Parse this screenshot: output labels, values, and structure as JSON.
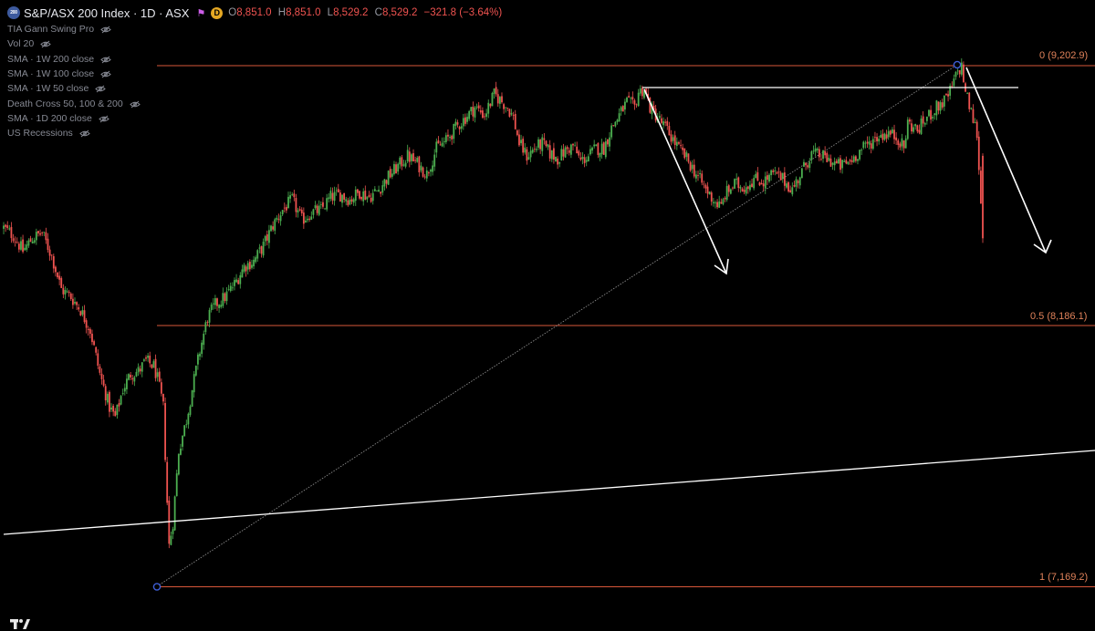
{
  "header": {
    "title": "S&P/ASX 200 Index · 1D · ASX",
    "logo_text": "200",
    "badge": "D",
    "ohlc": [
      {
        "key": "O",
        "value": "8,851.0"
      },
      {
        "key": "H",
        "value": "8,851.0"
      },
      {
        "key": "L",
        "value": "8,529.2"
      },
      {
        "key": "C",
        "value": "8,529.2"
      }
    ],
    "change": "−321.8 (−3.64%)"
  },
  "indicators": [
    {
      "label": "TIA Gann Swing Pro"
    },
    {
      "label": "Vol 20"
    },
    {
      "label": "SMA · 1W 200 close"
    },
    {
      "label": "SMA · 1W 100 close"
    },
    {
      "label": "SMA · 1W 50 close"
    },
    {
      "label": "Death Cross 50, 100 & 200"
    },
    {
      "label": "SMA · 1D 200 close"
    },
    {
      "label": "US Recessions"
    }
  ],
  "colors": {
    "background": "#000000",
    "up": "#4caf50",
    "down": "#ef5350",
    "fib_line": "#d9573a",
    "fib_text": "#e0825a",
    "drawing": "#ffffff",
    "pivot": "#3f5fd8"
  },
  "chart_data": {
    "type": "candlestick",
    "title": "S&P/ASX 200 Index · 1D · ASX",
    "ylim": [
      7080,
      9290
    ],
    "fib_levels": [
      {
        "label": "0 (9,202.9)",
        "ratio": 0,
        "value": 9202.9
      },
      {
        "label": "0.5 (8,186.1)",
        "ratio": 0.5,
        "value": 8186.1
      },
      {
        "label": "1 (7,169.2)",
        "ratio": 1,
        "value": 7169.2
      }
    ],
    "close_path": [
      [
        0,
        8570
      ],
      [
        5,
        8540
      ],
      [
        10,
        8480
      ],
      [
        15,
        8530
      ],
      [
        20,
        8550
      ],
      [
        25,
        8460
      ],
      [
        30,
        8330
      ],
      [
        35,
        8300
      ],
      [
        40,
        8250
      ],
      [
        45,
        8170
      ],
      [
        50,
        8000
      ],
      [
        55,
        7870
      ],
      [
        58,
        7830
      ],
      [
        62,
        7940
      ],
      [
        66,
        8000
      ],
      [
        70,
        8010
      ],
      [
        74,
        8050
      ],
      [
        78,
        8030
      ],
      [
        80,
        7980
      ],
      [
        83,
        7870
      ],
      [
        85,
        7500
      ],
      [
        86,
        7330
      ],
      [
        88,
        7420
      ],
      [
        91,
        7700
      ],
      [
        95,
        7820
      ],
      [
        98,
        7940
      ],
      [
        102,
        8090
      ],
      [
        106,
        8220
      ],
      [
        110,
        8270
      ],
      [
        115,
        8300
      ],
      [
        120,
        8350
      ],
      [
        125,
        8420
      ],
      [
        130,
        8440
      ],
      [
        135,
        8500
      ],
      [
        140,
        8580
      ],
      [
        145,
        8640
      ],
      [
        150,
        8680
      ],
      [
        155,
        8600
      ],
      [
        160,
        8630
      ],
      [
        165,
        8640
      ],
      [
        170,
        8690
      ],
      [
        175,
        8700
      ],
      [
        180,
        8680
      ],
      [
        185,
        8710
      ],
      [
        190,
        8690
      ],
      [
        195,
        8720
      ],
      [
        200,
        8770
      ],
      [
        205,
        8810
      ],
      [
        210,
        8850
      ],
      [
        215,
        8820
      ],
      [
        220,
        8780
      ],
      [
        225,
        8880
      ],
      [
        230,
        8910
      ],
      [
        235,
        8960
      ],
      [
        240,
        9000
      ],
      [
        245,
        9040
      ],
      [
        250,
        9010
      ],
      [
        255,
        9090
      ],
      [
        258,
        9070
      ],
      [
        262,
        9040
      ],
      [
        265,
        9000
      ],
      [
        268,
        8900
      ],
      [
        272,
        8850
      ],
      [
        276,
        8880
      ],
      [
        280,
        8900
      ],
      [
        284,
        8860
      ],
      [
        288,
        8840
      ],
      [
        292,
        8870
      ],
      [
        296,
        8890
      ],
      [
        300,
        8830
      ],
      [
        304,
        8850
      ],
      [
        308,
        8880
      ],
      [
        312,
        8880
      ],
      [
        316,
        8960
      ],
      [
        320,
        9010
      ],
      [
        324,
        9060
      ],
      [
        328,
        9040
      ],
      [
        330,
        9100
      ],
      [
        333,
        9110
      ],
      [
        336,
        9040
      ],
      [
        340,
        9000
      ],
      [
        345,
        8950
      ],
      [
        350,
        8890
      ],
      [
        355,
        8840
      ],
      [
        360,
        8780
      ],
      [
        365,
        8720
      ],
      [
        370,
        8670
      ],
      [
        373,
        8650
      ],
      [
        375,
        8700
      ],
      [
        380,
        8740
      ],
      [
        385,
        8730
      ],
      [
        390,
        8760
      ],
      [
        395,
        8750
      ],
      [
        400,
        8780
      ],
      [
        405,
        8760
      ],
      [
        410,
        8720
      ],
      [
        415,
        8790
      ],
      [
        420,
        8860
      ],
      [
        425,
        8850
      ],
      [
        430,
        8830
      ],
      [
        435,
        8810
      ],
      [
        440,
        8830
      ],
      [
        445,
        8870
      ],
      [
        450,
        8900
      ],
      [
        455,
        8930
      ],
      [
        460,
        8940
      ],
      [
        465,
        8920
      ],
      [
        468,
        8880
      ],
      [
        470,
        8980
      ],
      [
        475,
        8950
      ],
      [
        480,
        9000
      ],
      [
        485,
        9040
      ],
      [
        490,
        9070
      ],
      [
        493,
        9120
      ],
      [
        496,
        9180
      ],
      [
        498,
        9200
      ],
      [
        500,
        9100
      ],
      [
        503,
        9020
      ],
      [
        506,
        8940
      ],
      [
        509,
        8529.2
      ]
    ]
  },
  "drawings": {
    "arrow_left": "arrow down",
    "arrow_right": "arrow down"
  }
}
